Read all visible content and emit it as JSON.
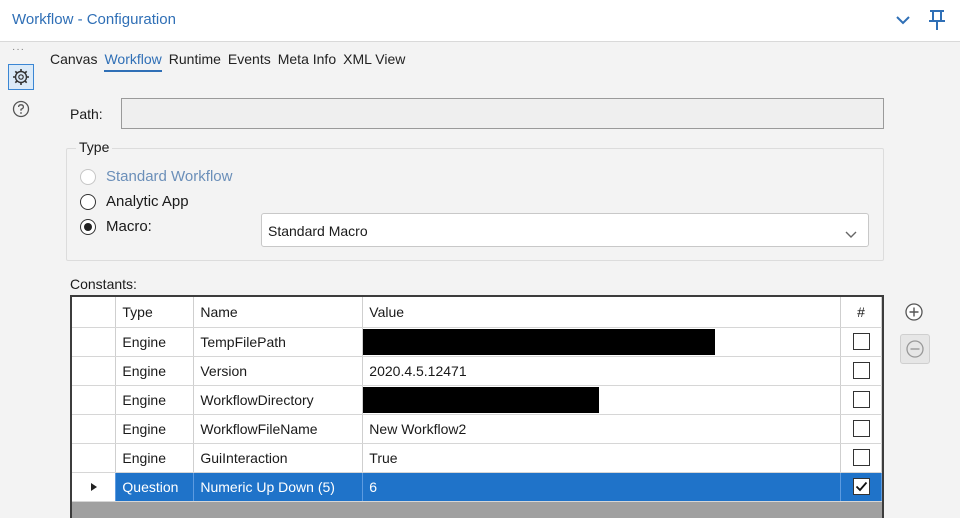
{
  "window": {
    "title": "Workflow - Configuration"
  },
  "tabs": [
    {
      "label": "Canvas",
      "active": false
    },
    {
      "label": "Workflow",
      "active": true
    },
    {
      "label": "Runtime",
      "active": false
    },
    {
      "label": "Events",
      "active": false
    },
    {
      "label": "Meta Info",
      "active": false
    },
    {
      "label": "XML View",
      "active": false
    }
  ],
  "path": {
    "label": "Path:",
    "value": ""
  },
  "type": {
    "legend": "Type",
    "options": [
      {
        "label": "Standard Workflow",
        "selected": false,
        "disabled": true
      },
      {
        "label": "Analytic App",
        "selected": false,
        "disabled": false
      },
      {
        "label": "Macro:",
        "selected": true,
        "disabled": false
      }
    ],
    "macro_select": {
      "value": "Standard Macro"
    }
  },
  "constants": {
    "label": "Constants:",
    "columns": [
      "Type",
      "Name",
      "Value",
      "#"
    ],
    "rows": [
      {
        "type": "Engine",
        "name": "TempFilePath",
        "value": "",
        "redacted": true,
        "checked": false,
        "selected": false
      },
      {
        "type": "Engine",
        "name": "Version",
        "value": "2020.4.5.12471",
        "redacted": false,
        "checked": false,
        "selected": false
      },
      {
        "type": "Engine",
        "name": "WorkflowDirectory",
        "value": "",
        "redacted": true,
        "checked": false,
        "selected": false
      },
      {
        "type": "Engine",
        "name": "WorkflowFileName",
        "value": "New Workflow2",
        "redacted": false,
        "checked": false,
        "selected": false
      },
      {
        "type": "Engine",
        "name": "GuiInteraction",
        "value": "True",
        "redacted": false,
        "checked": false,
        "selected": false
      },
      {
        "type": "Question",
        "name": "Numeric Up Down (5)",
        "value": "6",
        "redacted": false,
        "checked": true,
        "selected": true
      }
    ]
  },
  "icons": {
    "collapse": "chevron-down-icon",
    "pin": "pin-icon",
    "settings": "gear-icon",
    "help": "help-icon",
    "add": "plus-circle-icon",
    "remove": "minus-circle-icon"
  },
  "colors": {
    "accent": "#2f6fb6",
    "selection": "#1f73c9"
  }
}
